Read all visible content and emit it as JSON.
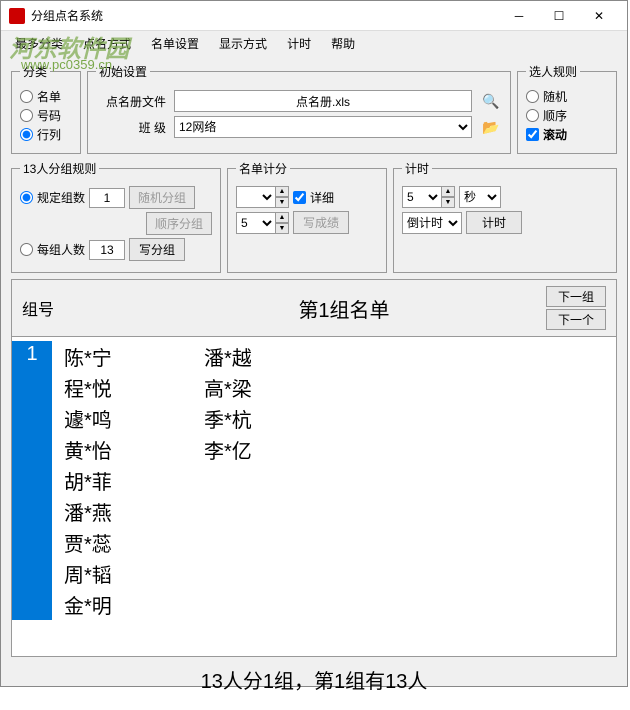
{
  "window": {
    "title": "分组点名系统"
  },
  "watermark": {
    "text": "河东软件园",
    "url": "www.pc0359.cn"
  },
  "menu": {
    "items": [
      "最多分类",
      "点名方式",
      "名单设置",
      "显示方式",
      "计时",
      "帮助"
    ]
  },
  "classify": {
    "legend": "分类",
    "opt1": "名单",
    "opt2": "号码",
    "opt3": "行列",
    "selected": "行列"
  },
  "init": {
    "legend": "初始设置",
    "file_label": "点名册文件",
    "file_value": "点名册.xls",
    "class_label": "班  级",
    "class_value": "12网络"
  },
  "pick_rule": {
    "legend": "选人规则",
    "opt1": "随机",
    "opt2": "顺序",
    "opt3": "滚动",
    "selected": "滚动"
  },
  "group_rule": {
    "legend": "13人分组规则",
    "opt1": "规定组数",
    "opt2": "每组人数",
    "val1": "1",
    "val2": "13",
    "btn_random": "随机分组",
    "btn_seq": "顺序分组",
    "btn_write": "写分组"
  },
  "score": {
    "legend": "名单计分",
    "detail": "详细",
    "sel1": "",
    "sel2": "5",
    "btn_write": "写成绩"
  },
  "timer": {
    "legend": "计时",
    "val": "5",
    "unit": "秒",
    "mode": "倒计时",
    "btn": "计时"
  },
  "list": {
    "left_label": "组号",
    "title": "第1组名单",
    "btn_next_group": "下一组",
    "btn_next_one": "下一个",
    "group_num": "1",
    "col1": [
      "陈*宁",
      "程*悦",
      "遽*鸣",
      "黄*怡",
      "胡*菲",
      "潘*燕",
      "贾*蕊",
      "周*韬",
      "金*明"
    ],
    "col2": [
      "潘*越",
      "高*梁",
      "季*杭",
      "李*亿"
    ]
  },
  "status": "13人分1组，第1组有13人"
}
